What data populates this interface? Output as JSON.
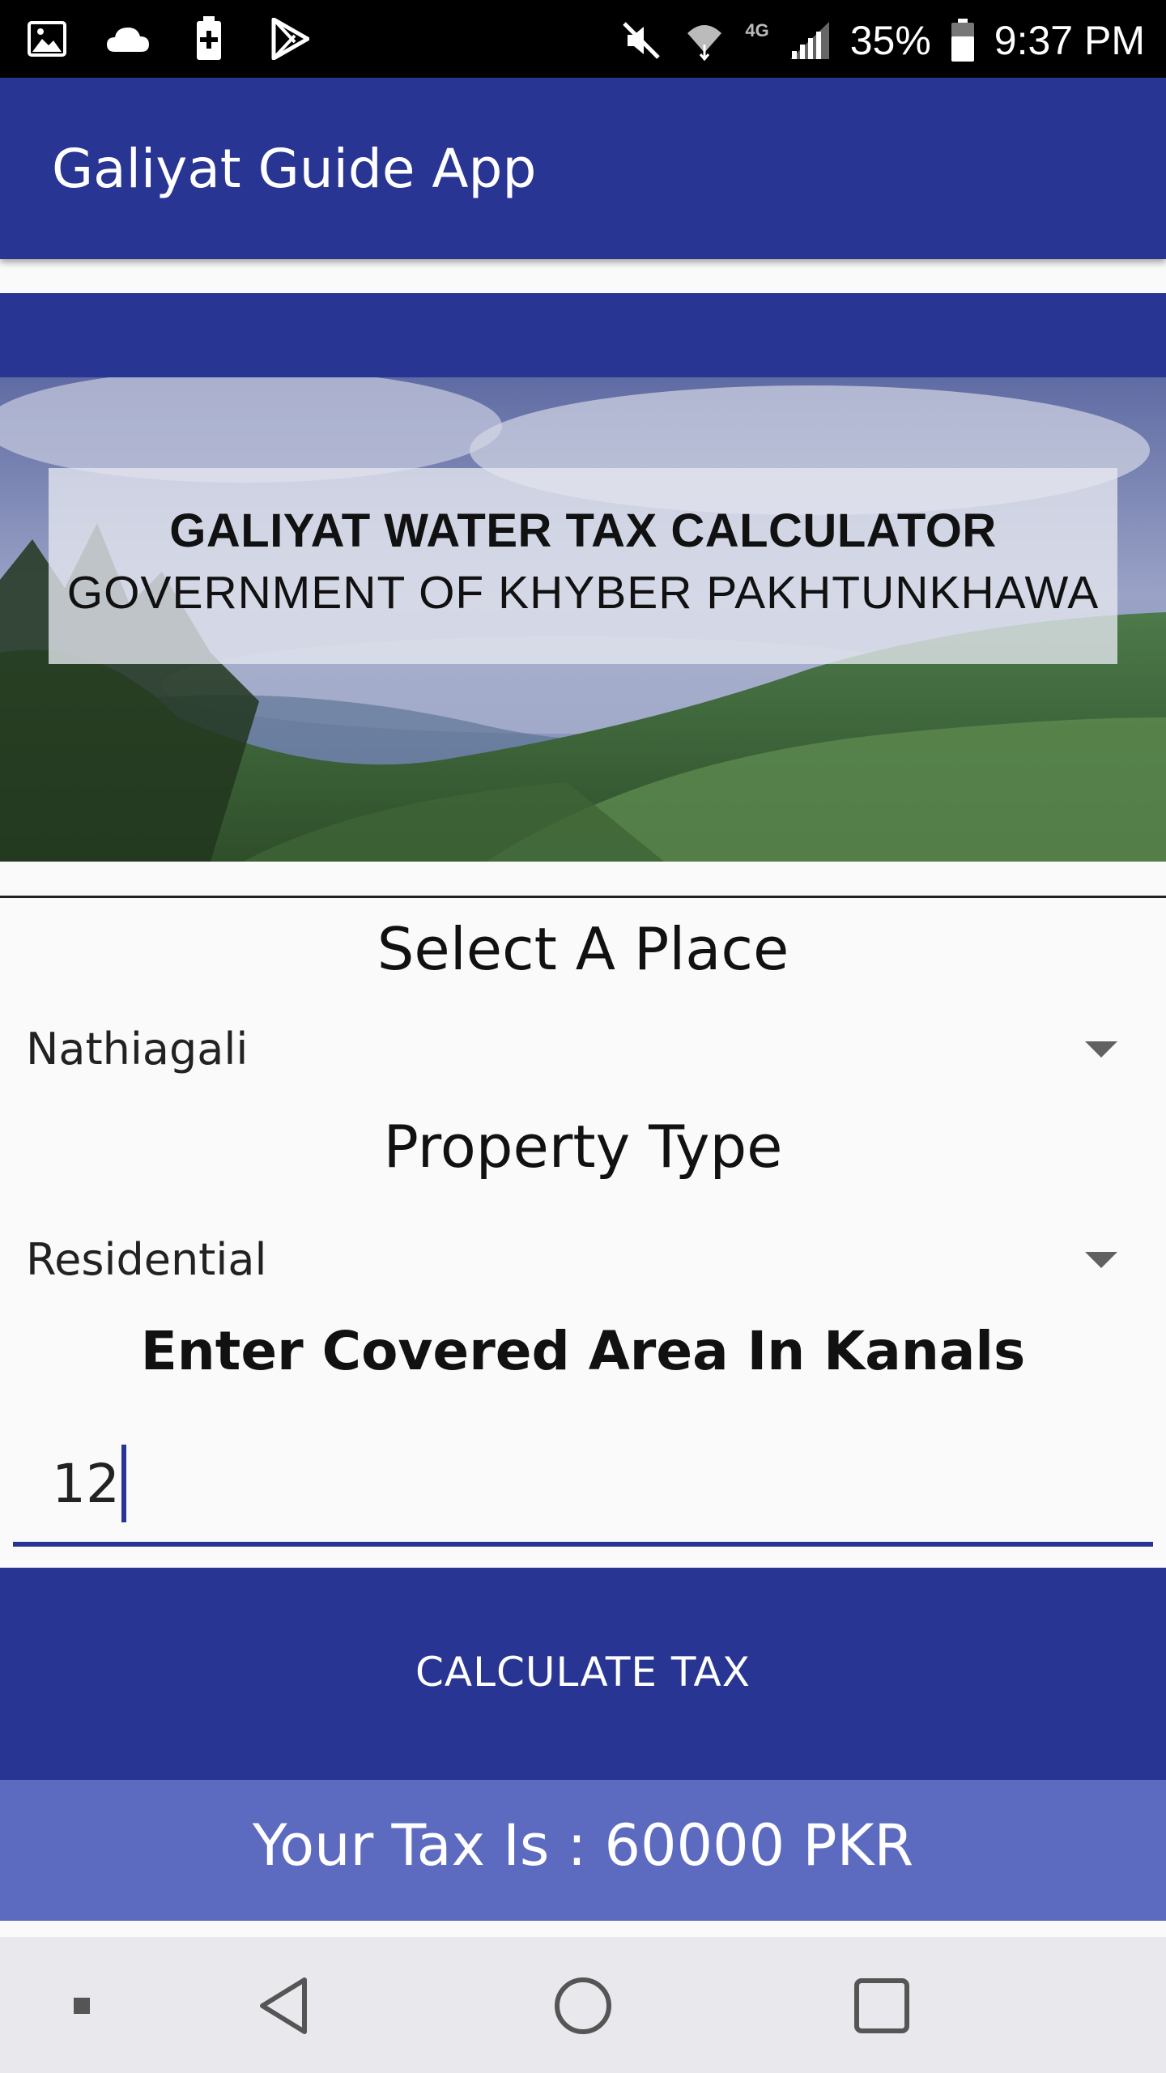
{
  "status_bar": {
    "left_icons": [
      "gallery-icon",
      "cloud-icon",
      "battery-saver-icon",
      "play-store-icon"
    ],
    "right_icons": [
      "mute-icon",
      "wifi-icon",
      "lte-icon",
      "signal-icon",
      "battery-icon"
    ],
    "network_label": "4G",
    "battery_percent": "35%",
    "time": "9:37 PM"
  },
  "app_bar": {
    "title": "Galiyat Guide App",
    "color": "#283593"
  },
  "banner": {
    "title": "GALIYAT WATER TAX CALCULATOR",
    "subtitle": "GOVERNMENT OF KHYBER PAKHTUNKHAWA"
  },
  "form": {
    "place_heading": "Select A Place",
    "place_selected": "Nathiagali",
    "property_heading": "Property Type",
    "property_selected": "Residential",
    "area_heading": "Enter Covered Area In Kanals",
    "area_value": "12"
  },
  "calculate_button": {
    "label": "CALCULATE TAX"
  },
  "result": {
    "text": "Your Tax Is : 60000 PKR",
    "color": "#5c6bc0"
  },
  "nav_bar": {
    "items": [
      "recents-dot-icon",
      "back-icon",
      "home-icon",
      "overview-icon"
    ]
  }
}
